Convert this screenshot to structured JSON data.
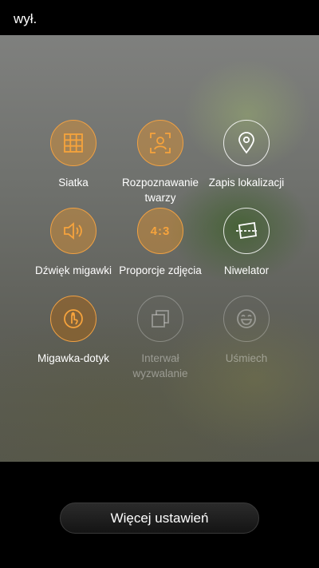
{
  "status": {
    "flash_label": "wył."
  },
  "settings": [
    {
      "label": "Siatka",
      "icon": "grid-icon",
      "state": "on"
    },
    {
      "label": "Rozpoznawanie twarzy",
      "icon": "face-detect-icon",
      "state": "on"
    },
    {
      "label": "Zapis lokalizacji",
      "icon": "location-pin-icon",
      "state": "off"
    },
    {
      "label": "Dźwięk migawki",
      "icon": "speaker-icon",
      "state": "on"
    },
    {
      "label": "Proporcje zdjęcia",
      "icon_text": "4:3",
      "icon": "aspect-ratio-icon",
      "state": "on"
    },
    {
      "label": "Niwelator",
      "icon": "level-icon",
      "state": "off"
    },
    {
      "label": "Migawka-dotyk",
      "icon": "touch-shutter-icon",
      "state": "on"
    },
    {
      "label": "Interwał wyzwalanie",
      "icon": "interval-icon",
      "state": "disabled"
    },
    {
      "label": "Uśmiech",
      "icon": "smile-icon",
      "state": "disabled"
    }
  ],
  "footer": {
    "more_settings_label": "Więcej ustawień"
  },
  "colors": {
    "accent": "#f1a143",
    "background": "#000000"
  }
}
